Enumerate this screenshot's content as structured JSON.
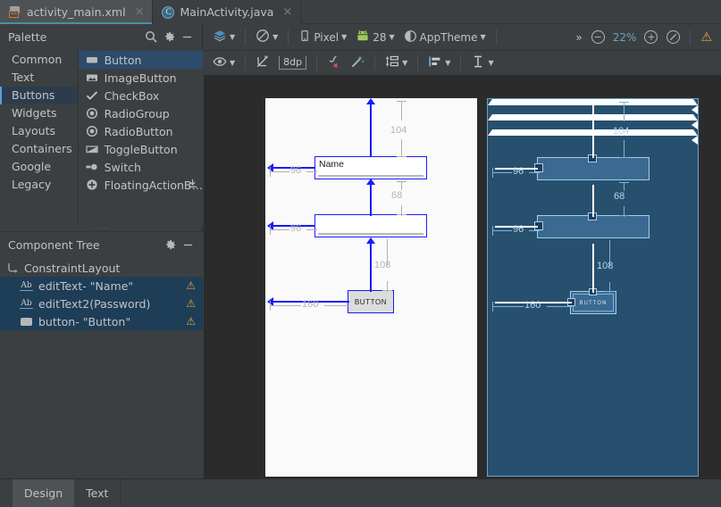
{
  "tabs": [
    {
      "label": "activity_main.xml",
      "icon": "xml-file-icon",
      "active": true,
      "close": "×"
    },
    {
      "label": "MainActivity.java",
      "icon": "java-class-icon",
      "active": false,
      "close": "×"
    }
  ],
  "palette": {
    "title": "Palette",
    "search_icon": "search-icon",
    "gear_icon": "gear-icon",
    "minimize_icon": "minimize-icon",
    "categories": [
      {
        "label": "Common",
        "selected": false
      },
      {
        "label": "Text",
        "selected": false
      },
      {
        "label": "Buttons",
        "selected": true
      },
      {
        "label": "Widgets",
        "selected": false
      },
      {
        "label": "Layouts",
        "selected": false
      },
      {
        "label": "Containers",
        "selected": false
      },
      {
        "label": "Google",
        "selected": false
      },
      {
        "label": "Legacy",
        "selected": false
      }
    ],
    "items": [
      {
        "label": "Button",
        "icon": "button-icon",
        "selected": true,
        "download": false
      },
      {
        "label": "ImageButton",
        "icon": "image-icon",
        "selected": false,
        "download": false
      },
      {
        "label": "CheckBox",
        "icon": "checkmark-icon",
        "selected": false,
        "download": false
      },
      {
        "label": "RadioGroup",
        "icon": "radio-icon",
        "selected": false,
        "download": false
      },
      {
        "label": "RadioButton",
        "icon": "radio-icon",
        "selected": false,
        "download": false
      },
      {
        "label": "ToggleButton",
        "icon": "toggle-icon",
        "selected": false,
        "download": false
      },
      {
        "label": "Switch",
        "icon": "switch-icon",
        "selected": false,
        "download": false
      },
      {
        "label": "FloatingActionB…",
        "icon": "plus-circle-icon",
        "selected": false,
        "download": true
      }
    ]
  },
  "component_tree": {
    "title": "Component Tree",
    "gear_icon": "gear-icon",
    "minimize_icon": "minimize-icon",
    "rows": [
      {
        "label": "ConstraintLayout",
        "icon": "constraint-layout-icon",
        "indent": 0,
        "selected": false,
        "warning": false
      },
      {
        "label": "editText- \"Name\"",
        "icon": "text-field-icon",
        "indent": 1,
        "selected": true,
        "warning": true
      },
      {
        "label": "editText2(Password)",
        "icon": "text-field-icon",
        "indent": 1,
        "selected": true,
        "warning": true
      },
      {
        "label": "button- \"Button\"",
        "icon": "button-icon",
        "indent": 1,
        "selected": true,
        "warning": true
      }
    ],
    "warning_glyph": "⚠"
  },
  "toolbar_top": {
    "layers_label": "",
    "layers_icon": "layers-icon",
    "orientation_icon": "rotate-orientation-icon",
    "device_icon": "phone-icon",
    "device_label": "Pixel",
    "api_icon": "android-icon",
    "api_label": "28",
    "theme_icon": "theme-contrast-icon",
    "theme_label": "AppTheme",
    "overflow_label": "»",
    "zoom_out_icon": "zoom-out-icon",
    "zoom_value": "22%",
    "zoom_in_icon": "zoom-in-icon",
    "zoom_fit_icon": "zoom-fit-icon",
    "warning_icon": "warning-icon",
    "warning_glyph": "⚠"
  },
  "toolbar_second": {
    "view_options_icon": "eye-icon",
    "autoconnect_icon": "autoconnect-off-icon",
    "margin_value": "8dp",
    "clear_constraints_icon": "clear-constraints-icon",
    "infer_constraints_icon": "infer-constraints-icon",
    "pack_icon": "pack-icon",
    "align_icon": "align-icon",
    "guidelines_icon": "guidelines-icon"
  },
  "canvas": {
    "design": {
      "hint_text": "Name",
      "button_text": "BUTTON",
      "constraints": [
        {
          "name": "edittext1-top",
          "value": "104"
        },
        {
          "name": "edittext1-left",
          "value": "96"
        },
        {
          "name": "edittext2-top",
          "value": "68"
        },
        {
          "name": "edittext2-left",
          "value": "96"
        },
        {
          "name": "button-top",
          "value": "108"
        },
        {
          "name": "button-left",
          "value": "160"
        }
      ]
    },
    "blueprint": {
      "button_text": "BUTTON",
      "constraints": [
        {
          "name": "edittext1-top",
          "value": "104"
        },
        {
          "name": "edittext1-left",
          "value": "96"
        },
        {
          "name": "edittext2-top",
          "value": "68"
        },
        {
          "name": "edittext2-left",
          "value": "96"
        },
        {
          "name": "button-top",
          "value": "108"
        },
        {
          "name": "button-left",
          "value": "160"
        }
      ]
    }
  },
  "bottom_tabs": [
    {
      "label": "Design",
      "active": true
    },
    {
      "label": "Text",
      "active": false
    }
  ]
}
